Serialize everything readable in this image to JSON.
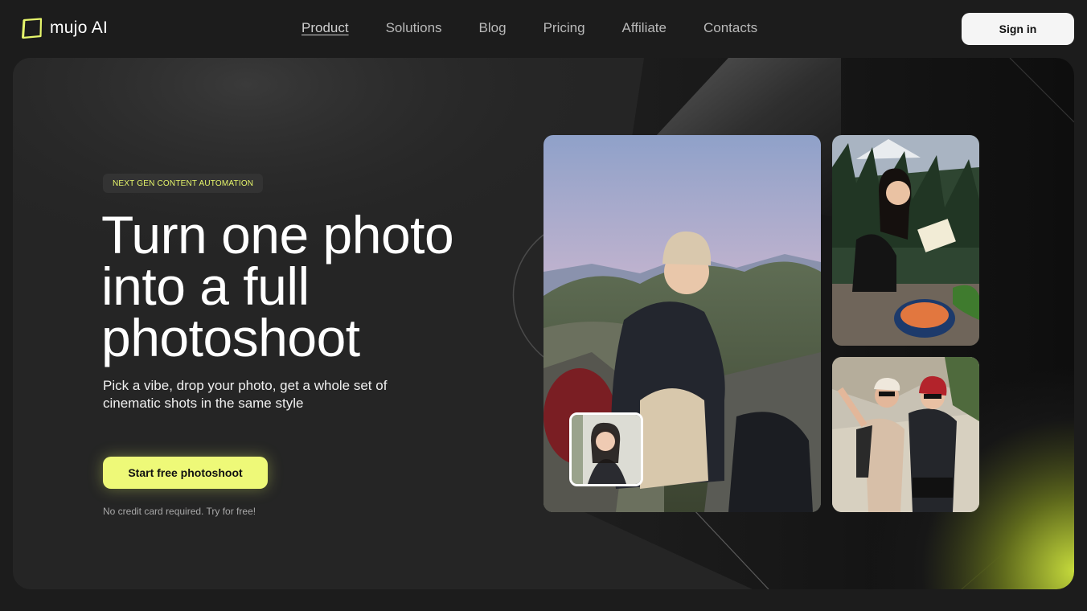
{
  "brand": {
    "name": "mujo AI"
  },
  "nav": {
    "items": [
      "Product",
      "Solutions",
      "Blog",
      "Pricing",
      "Affiliate",
      "Contacts"
    ],
    "active": "Product"
  },
  "header": {
    "signin_label": "Sign in"
  },
  "hero": {
    "badge": "NEXT GEN CONTENT AUTOMATION",
    "headline": "Turn one photo into a full photoshoot",
    "subhead": "Pick a vibe, drop your photo, get a whole set of cinematic shots in the same style",
    "cta_label": "Start free photoshoot",
    "note": "No credit card required. Try for free!"
  },
  "colors": {
    "accent": "#eef978",
    "background": "#1c1c1c",
    "card": "#252525"
  },
  "icons": [
    "mujo-logo-icon"
  ]
}
